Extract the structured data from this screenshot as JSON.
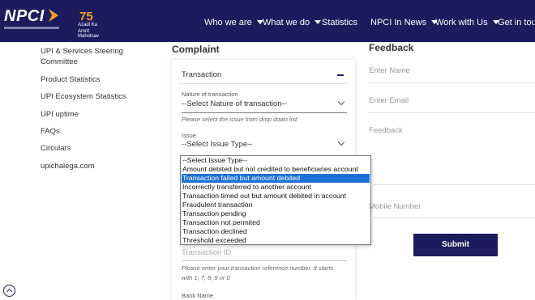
{
  "header": {
    "logo_text": "NPCI",
    "azadi": {
      "number": "75",
      "line1": "Azadi Ka",
      "line2": "Amrit Mahotsav"
    },
    "nav": [
      {
        "label": "Who we are",
        "has_caret": true
      },
      {
        "label": "What we do",
        "has_caret": true
      },
      {
        "label": "Statistics",
        "has_caret": false
      },
      {
        "label": "NPCI In News",
        "has_caret": true
      },
      {
        "label": "Work with Us",
        "has_caret": true
      },
      {
        "label": "Get in touch",
        "has_caret": false
      }
    ]
  },
  "sidebar": {
    "items": [
      {
        "label": "UPI & Services Steering Committee"
      },
      {
        "label": "Product Statistics"
      },
      {
        "label": "UPI Ecosystem Statistics"
      },
      {
        "label": "UPI uptime"
      },
      {
        "label": "FAQs"
      },
      {
        "label": "Circulars"
      },
      {
        "label": "upichalega.com"
      }
    ]
  },
  "complaint": {
    "title": "Complaint",
    "accordion_label": "Transaction",
    "nature": {
      "label": "Nature of transaction",
      "value": "--Select Nature of transaction--",
      "hint": "Please select the issue from drop down list"
    },
    "issue": {
      "label": "Issue",
      "value": "--Select Issue Type--"
    },
    "transaction_id": {
      "placeholder": "Transaction ID",
      "hint": "Please enter your transaction reference number. It starts with 1, 7, 8, 9 or 0"
    },
    "bank_name_label": "Bank Name"
  },
  "issue_dropdown": {
    "selected_index": 2,
    "options": [
      "--Select Issue Type--",
      "Amount debited but not credited to beneficiaries account",
      "Transaction failed but amount debited",
      "Incorrectly transferred to another account",
      "Transaction timed out but amount debited in account",
      "Fraudulent transaction",
      "Transaction pending",
      "Transaction not permited",
      "Transaction declined",
      "Threshold exceeded"
    ]
  },
  "feedback": {
    "title": "Feedback",
    "name_placeholder": "Enter Name",
    "email_placeholder": "Enter Email",
    "feedback_placeholder": "Feedback",
    "mobile_placeholder": "Mobile Number",
    "submit_label": "Submit"
  },
  "colors": {
    "brand_navy": "#1c1b5e",
    "selection_blue": "#1e70d6",
    "accent_orange": "#f7a21b"
  }
}
